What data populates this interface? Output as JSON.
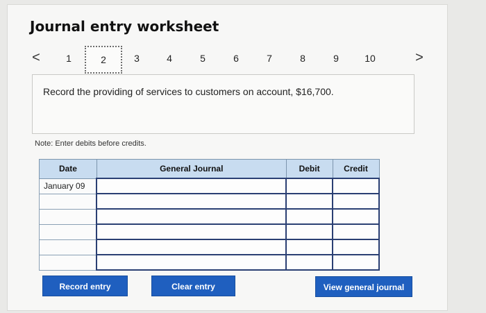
{
  "title": "Journal entry worksheet",
  "pager": {
    "prev": "<",
    "next": ">",
    "pages": [
      "1",
      "2",
      "3",
      "4",
      "5",
      "6",
      "7",
      "8",
      "9",
      "10"
    ],
    "active": "2"
  },
  "prompt": "Record the providing of services to customers on account, $16,700.",
  "note": "Note: Enter debits before credits.",
  "table": {
    "headers": [
      "Date",
      "General Journal",
      "Debit",
      "Credit"
    ],
    "rows": [
      [
        "January 09",
        "",
        "",
        ""
      ],
      [
        "",
        "",
        "",
        ""
      ],
      [
        "",
        "",
        "",
        ""
      ],
      [
        "",
        "",
        "",
        ""
      ],
      [
        "",
        "",
        "",
        ""
      ],
      [
        "",
        "",
        "",
        ""
      ]
    ]
  },
  "buttons": {
    "record": "Record entry",
    "clear": "Clear entry",
    "view": "View general journal"
  }
}
